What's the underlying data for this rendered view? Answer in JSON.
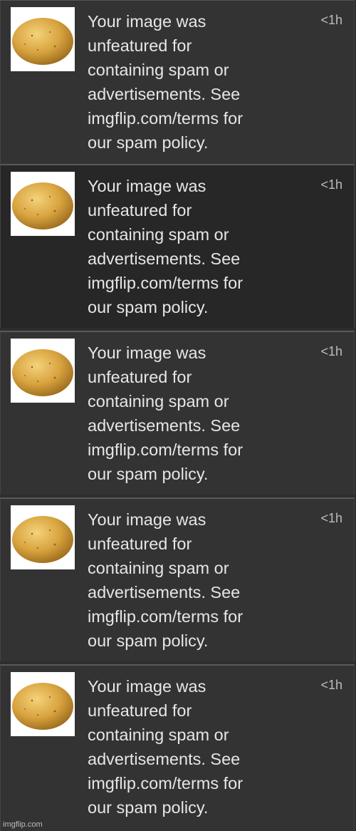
{
  "notifications": [
    {
      "thumbnail_icon": "potato-avatar",
      "message": "Your image was\nunfeatured for\ncontaining spam or\nadvertisements. See\nimgflip.com/terms for\nour spam policy.",
      "time": "<1h"
    },
    {
      "thumbnail_icon": "potato-avatar",
      "message": "Your image was\nunfeatured for\ncontaining spam or\nadvertisements. See\nimgflip.com/terms for\nour spam policy.",
      "time": "<1h"
    },
    {
      "thumbnail_icon": "potato-avatar",
      "message": "Your image was\nunfeatured for\ncontaining spam or\nadvertisements. See\nimgflip.com/terms for\nour spam policy.",
      "time": "<1h"
    },
    {
      "thumbnail_icon": "potato-avatar",
      "message": "Your image was\nunfeatured for\ncontaining spam or\nadvertisements. See\nimgflip.com/terms for\nour spam policy.",
      "time": "<1h"
    },
    {
      "thumbnail_icon": "potato-avatar",
      "message": "Your image was\nunfeatured for\ncontaining spam or\nadvertisements. See\nimgflip.com/terms for\nour spam policy.",
      "time": "<1h"
    }
  ],
  "watermark": "imgflip.com",
  "colors": {
    "background": "#333333",
    "highlighted_row": "#272727",
    "text": "#e6e6e6",
    "time_text": "#bdbdbd"
  }
}
